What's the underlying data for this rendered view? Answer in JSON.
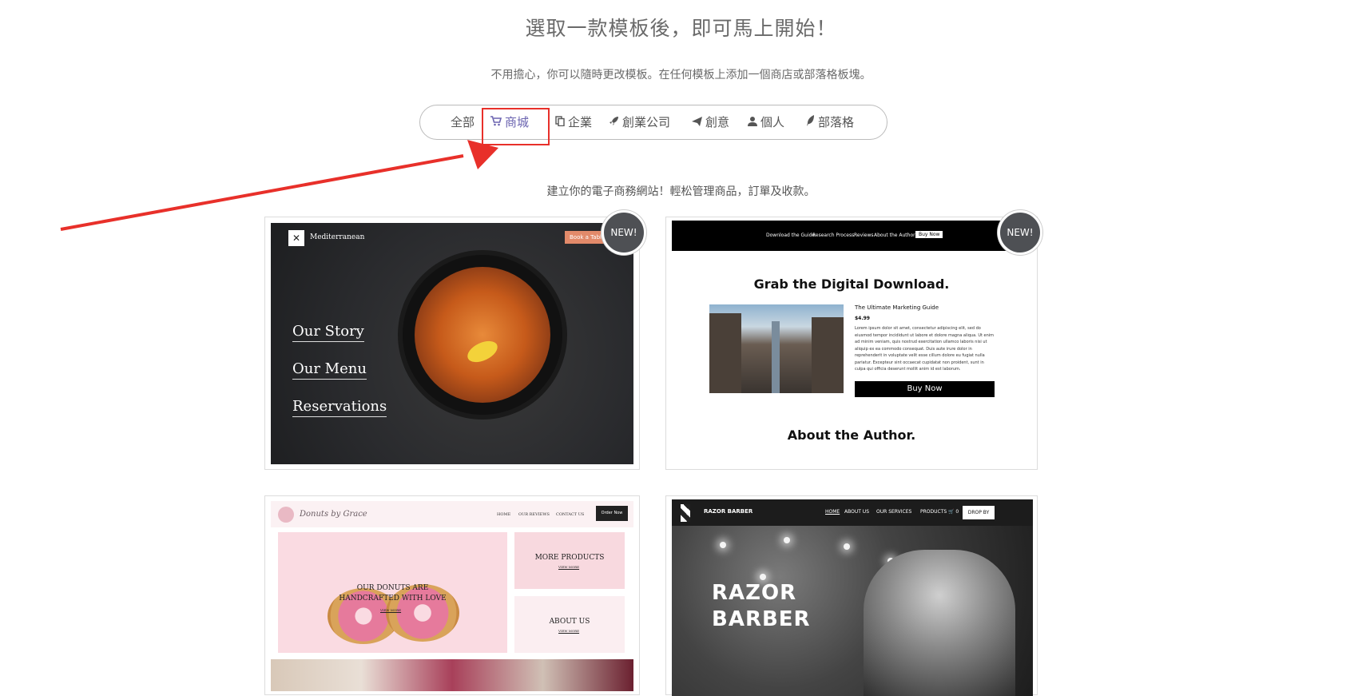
{
  "heading": "選取一款模板後，即可馬上開始！",
  "subheading": "不用擔心，你可以隨時更改模板。在任何模板上添加一個商店或部落格板塊。",
  "filters": [
    {
      "label": "全部",
      "icon": "none"
    },
    {
      "label": "商城",
      "icon": "cart-icon"
    },
    {
      "label": "企業",
      "icon": "copy-icon"
    },
    {
      "label": "創業公司",
      "icon": "rocket-icon"
    },
    {
      "label": "創意",
      "icon": "paper-plane-icon"
    },
    {
      "label": "個人",
      "icon": "user-icon"
    },
    {
      "label": "部落格",
      "icon": "feather-icon"
    }
  ],
  "active_filter": "商城",
  "tagline": "建立你的電子商務網站！輕松管理商品，訂單及收款。",
  "colors": {
    "accent": "#6b64b0",
    "annotation": "#e8302a",
    "badge": "#4e5054"
  },
  "templates": {
    "mediterranean": {
      "badge": "NEW!",
      "brand": "Mediterranean",
      "book": "Book a Table",
      "menu": [
        "Our Story",
        "Our Menu",
        "Reservations"
      ]
    },
    "digital": {
      "badge": "NEW!",
      "nav": [
        "Download the Guide",
        "Research Process",
        "Reviews",
        "About the Author"
      ],
      "nav_button": "Buy Now",
      "title": "Grab the Digital Download.",
      "guide_name": "The Ultimate Marketing Guide",
      "price": "$4.99",
      "lorem": "Lorem ipsum dolor sit amet, consectetur adipiscing elit, sed do eiusmod tempor incididunt ut labore et dolore magna aliqua. Ut enim ad minim veniam, quis nostrud exercitation ullamco laboris nisi ut aliquip ex ea commodo consequat. Duis aute irure dolor in reprehenderit in voluptate velit esse cillum dolore eu fugiat nulla pariatur. Excepteur sint occaecat cupidatat non proident, sunt in culpa qui officia deserunt mollit anim id est laborum.",
      "buy_button": "Buy Now",
      "about": "About the Author."
    },
    "donuts": {
      "brand": "Donuts by Grace",
      "nav": [
        "HOME",
        "OUR REVIEWS",
        "CONTACT US"
      ],
      "order_button": "Order Now",
      "hero_line1": "OUR DONUTS ARE",
      "hero_line2": "HANDCRAFTED WITH LOVE",
      "view_more": "VIEW MORE",
      "box1": "MORE PRODUCTS",
      "box2": "ABOUT US"
    },
    "razor": {
      "brand": "RAZOR BARBER",
      "nav": [
        "HOME",
        "ABOUT US",
        "OUR SERVICES",
        "PRODUCTS",
        "🛒 0"
      ],
      "drop_button": "DROP BY",
      "title_line1": "RAZOR",
      "title_line2": "BARBER"
    }
  }
}
